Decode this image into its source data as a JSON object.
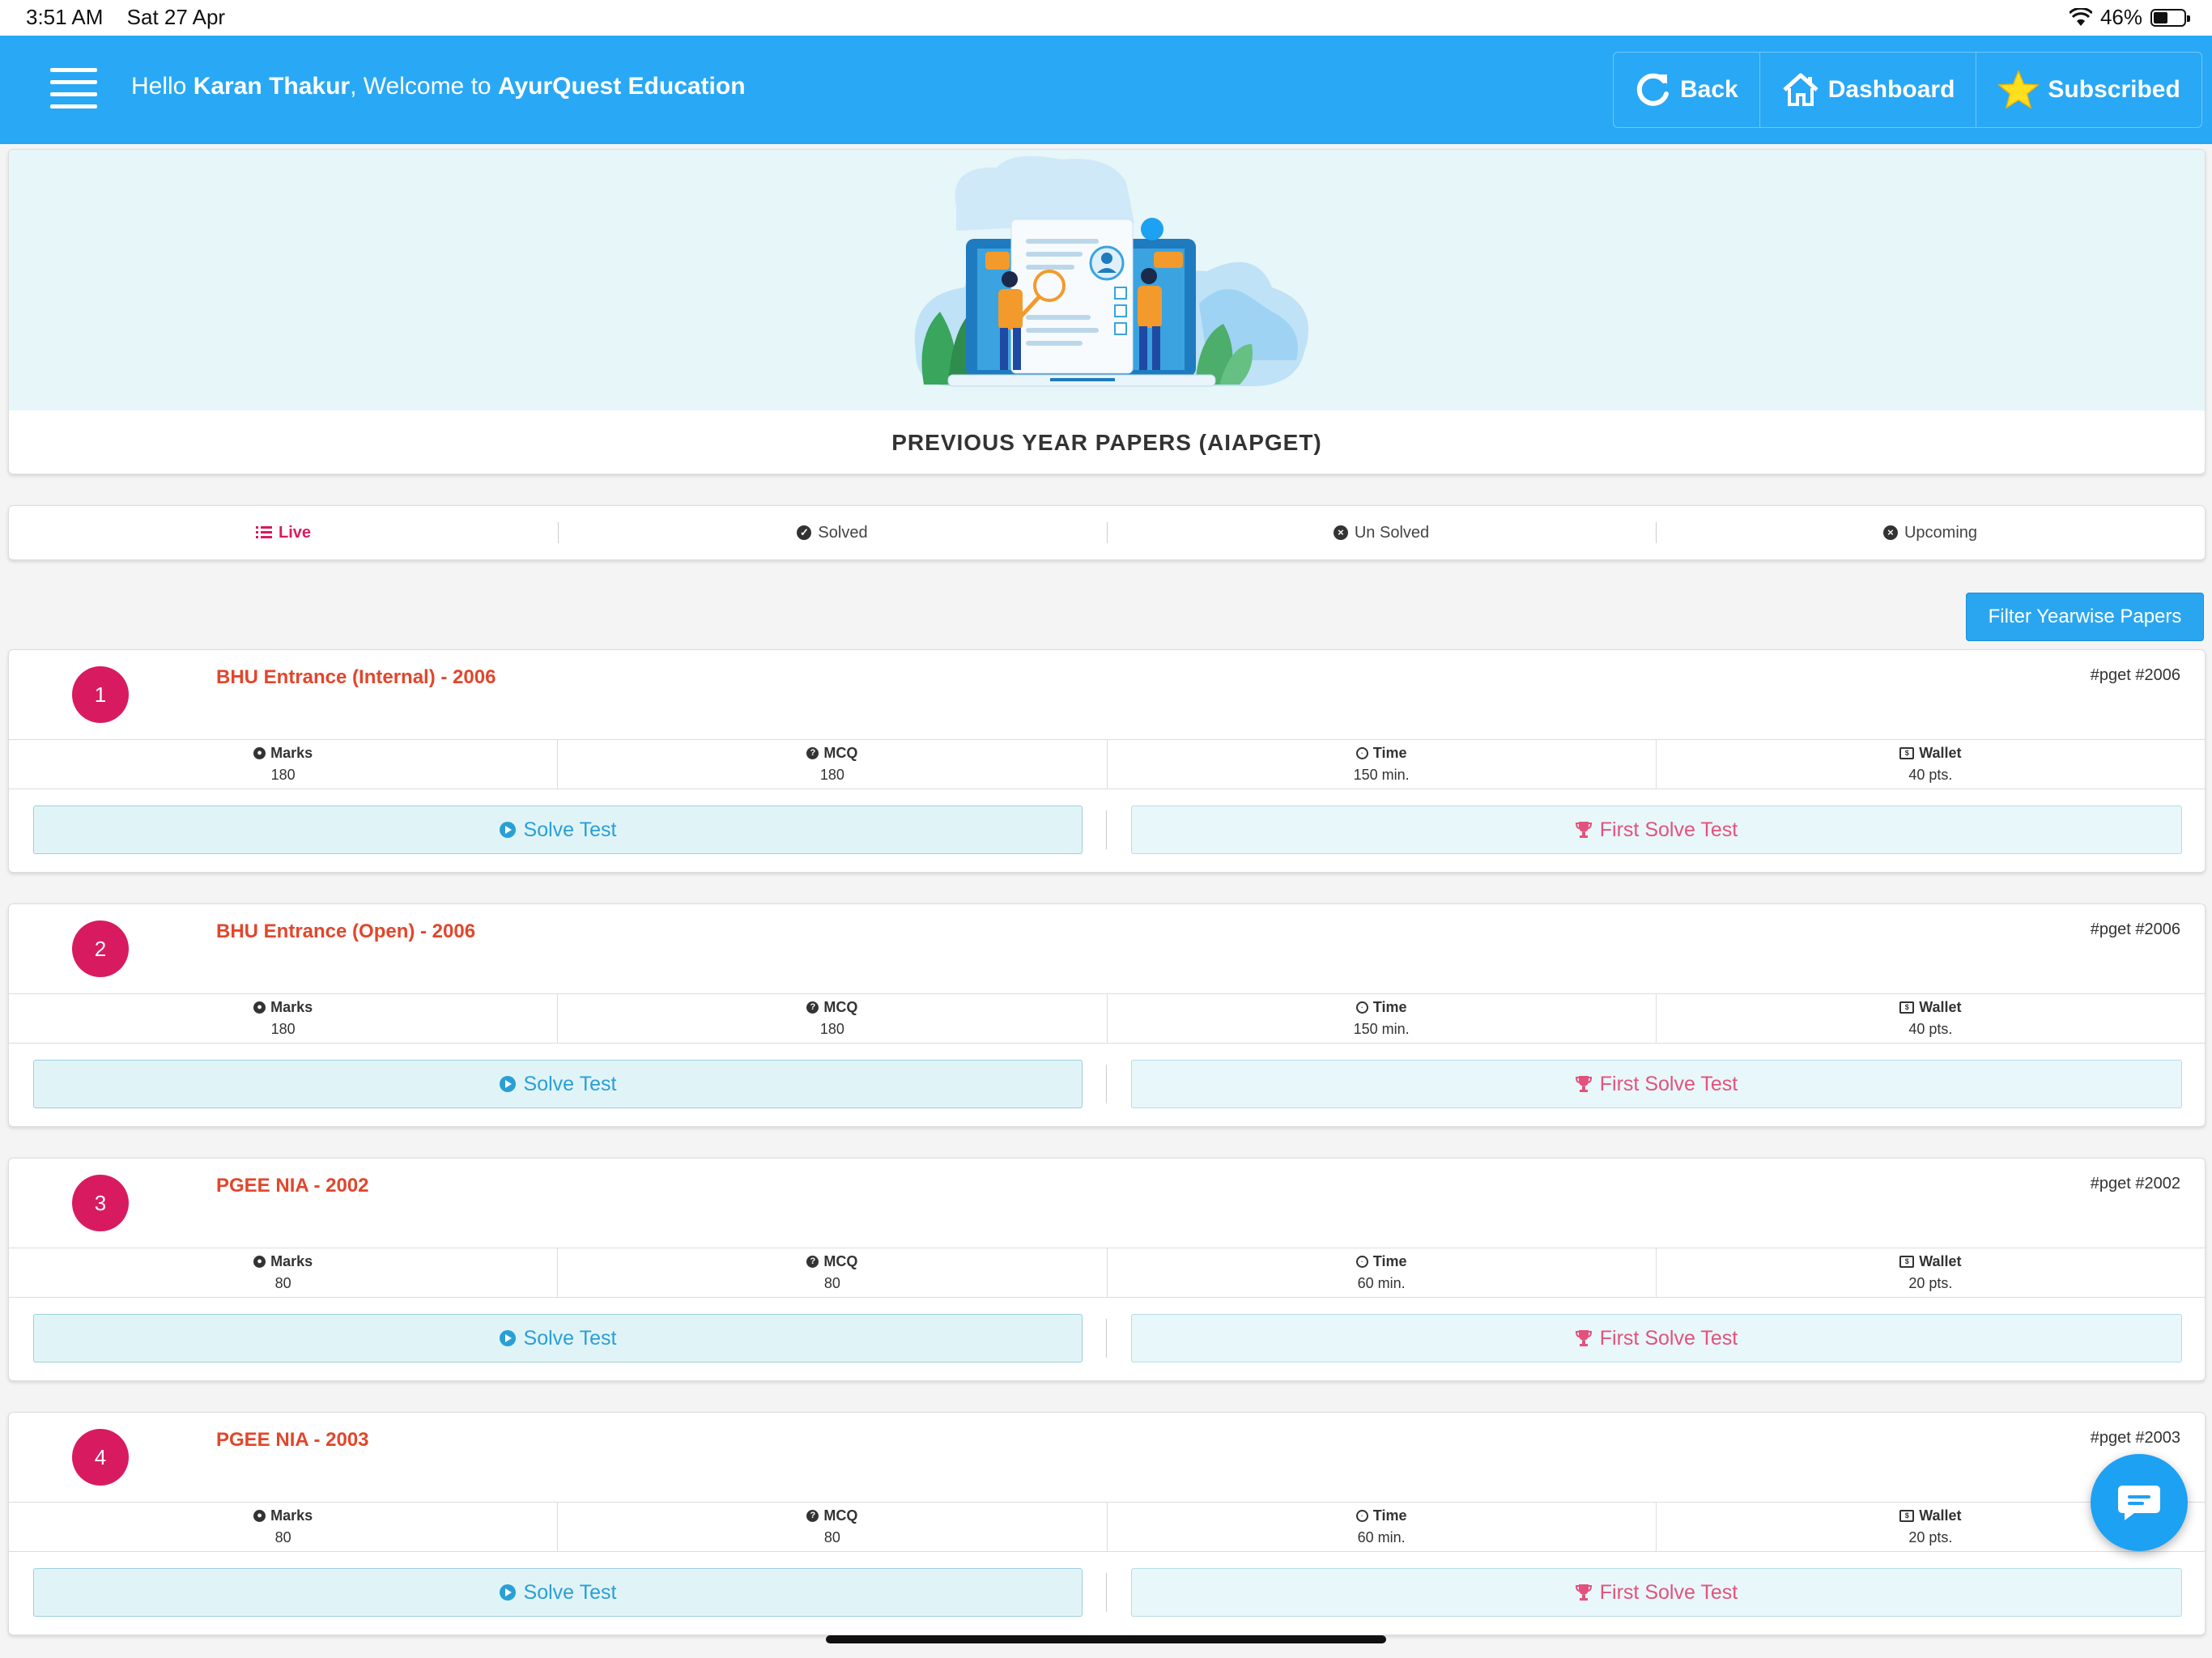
{
  "status_bar": {
    "time": "3:51 AM",
    "date": "Sat 27 Apr",
    "battery": "46%",
    "battery_level": 0.46
  },
  "header": {
    "greeting_prefix": "Hello ",
    "user_name": "Karan Thakur",
    "greeting_mid": ", Welcome to ",
    "brand": "AyurQuest Education",
    "buttons": {
      "back": "Back",
      "dashboard": "Dashboard",
      "subscribed": "Subscribed"
    },
    "color": "#29a8f5"
  },
  "hero": {
    "title": "PREVIOUS YEAR PAPERS (AIAPGET)"
  },
  "tabs": [
    {
      "label": "Live",
      "icon": "list-icon",
      "active": true
    },
    {
      "label": "Solved",
      "icon": "check-circle-icon"
    },
    {
      "label": "Un Solved",
      "icon": "x-circle-icon"
    },
    {
      "label": "Upcoming",
      "icon": "x-circle-icon"
    }
  ],
  "filter_button": "Filter Yearwise Papers",
  "stat_labels": {
    "marks": "Marks",
    "mcq": "MCQ",
    "time": "Time",
    "wallet": "Wallet"
  },
  "actions": {
    "solve": "Solve Test",
    "first_solve": "First Solve Test"
  },
  "papers": [
    {
      "num": "1",
      "title": "BHU Entrance (Internal) - 2006",
      "tags": "#pget #2006",
      "marks": "180",
      "mcq": "180",
      "time": "150 min.",
      "wallet": "40 pts."
    },
    {
      "num": "2",
      "title": "BHU Entrance (Open) - 2006",
      "tags": "#pget #2006",
      "marks": "180",
      "mcq": "180",
      "time": "150 min.",
      "wallet": "40 pts."
    },
    {
      "num": "3",
      "title": "PGEE NIA - 2002",
      "tags": "#pget #2002",
      "marks": "80",
      "mcq": "80",
      "time": "60 min.",
      "wallet": "20 pts."
    },
    {
      "num": "4",
      "title": "PGEE NIA - 2003",
      "tags": "#pget #2003",
      "marks": "80",
      "mcq": "80",
      "time": "60 min.",
      "wallet": "20 pts."
    }
  ],
  "colors": {
    "accent": "#29a8f5",
    "number_badge": "#d81b60",
    "paper_title": "#e2462c",
    "solve_text": "#2a9fd6",
    "first_solve_text": "#e3527c"
  }
}
